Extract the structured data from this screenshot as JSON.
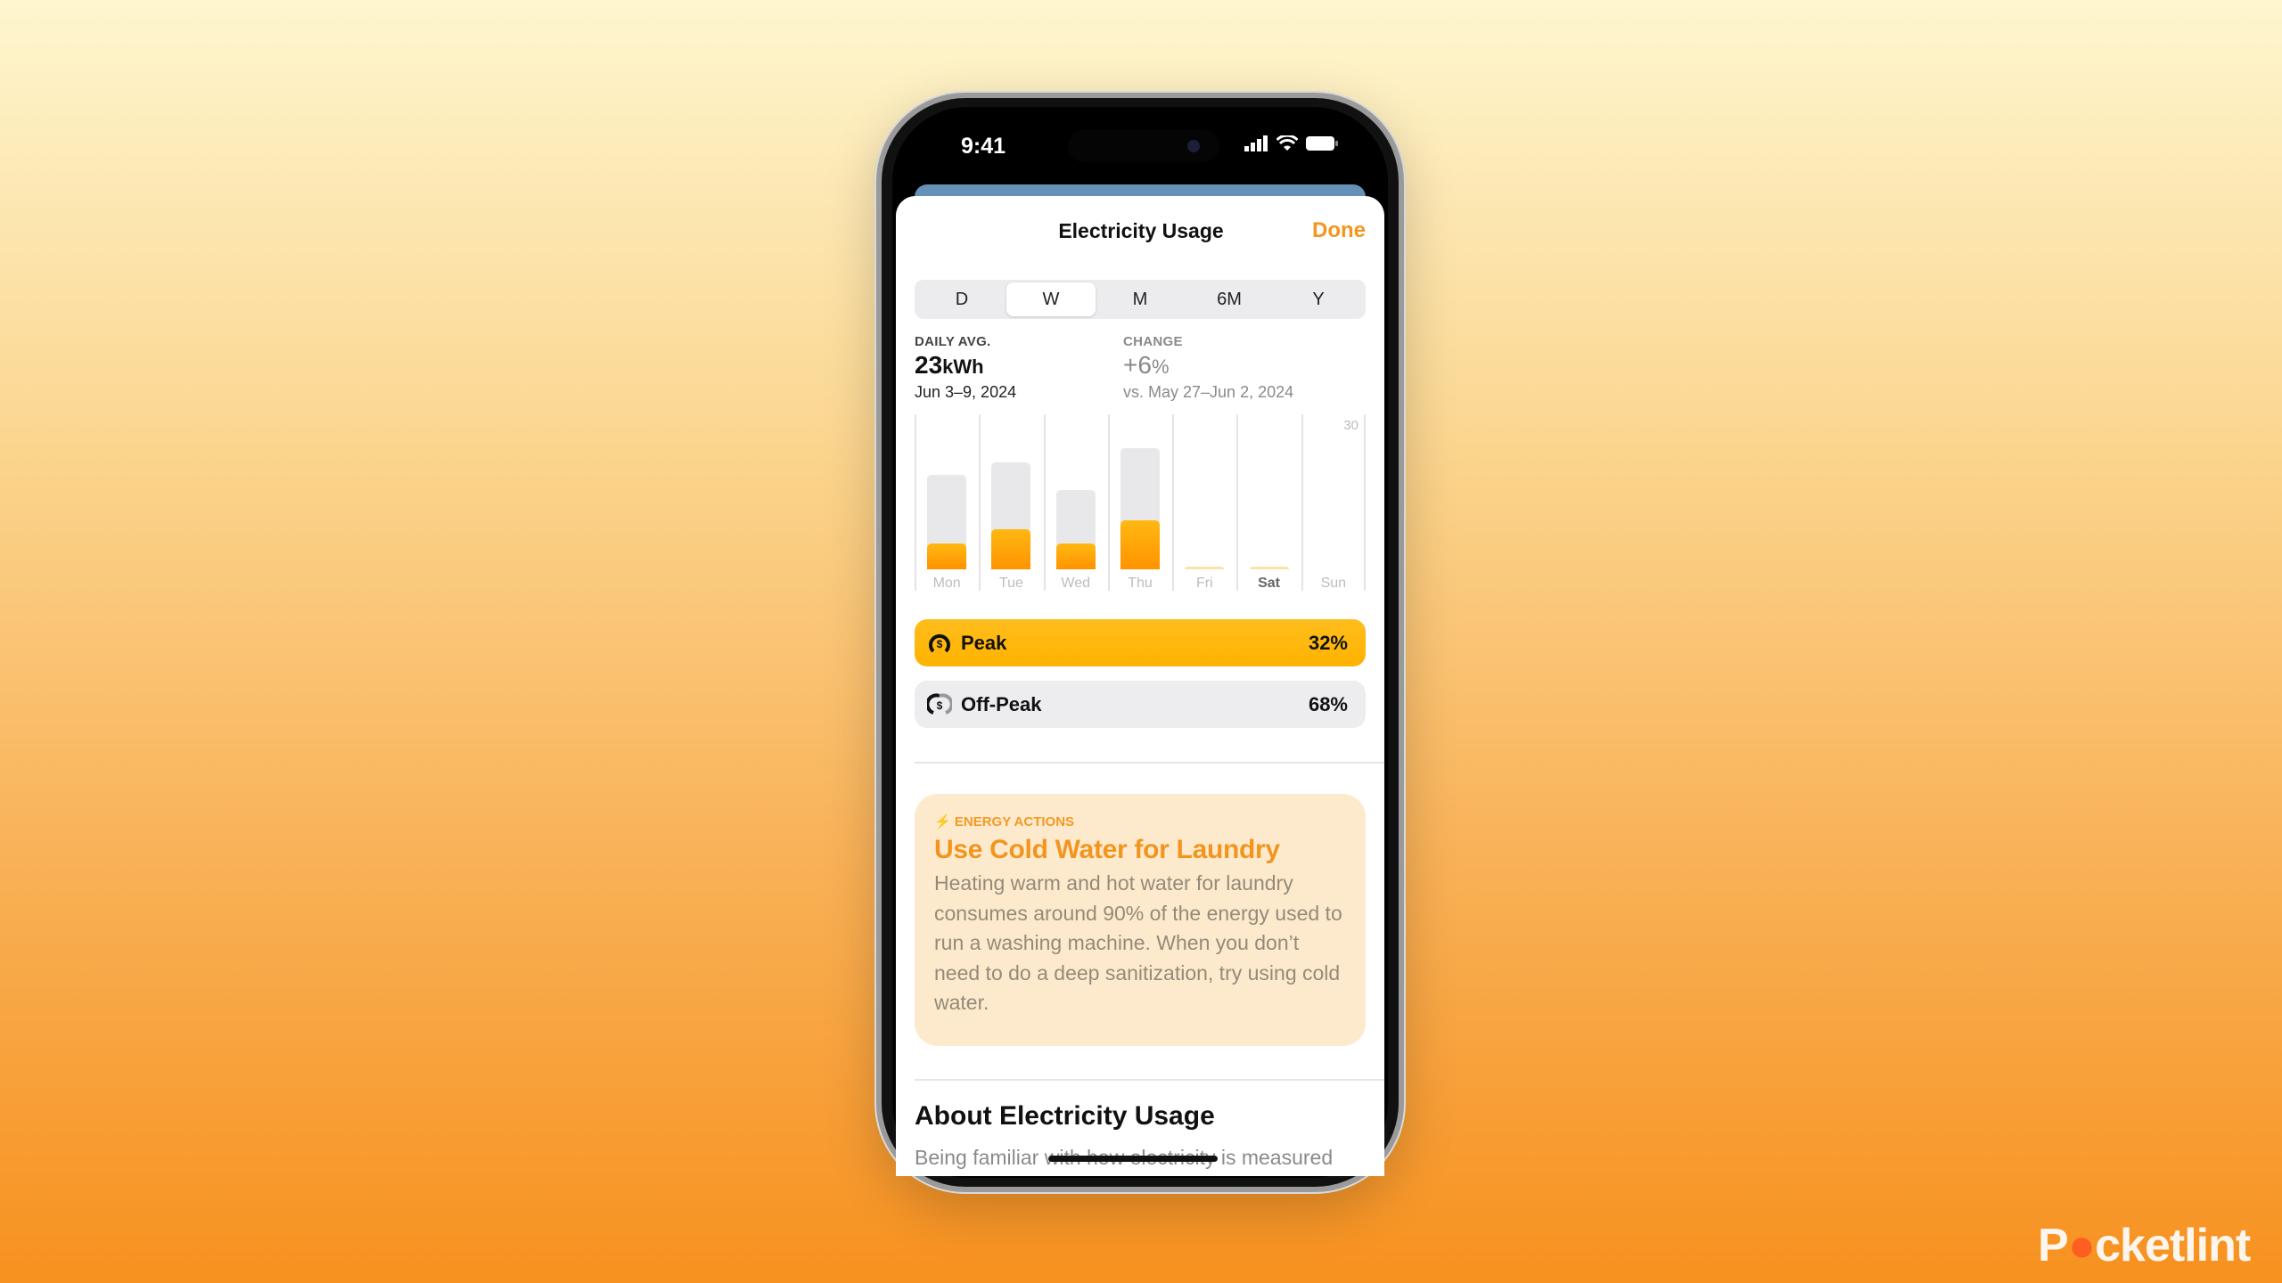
{
  "status_bar": {
    "time": "9:41",
    "icons": [
      "cellular-signal-icon",
      "wifi-icon",
      "battery-icon"
    ]
  },
  "header": {
    "title": "Electricity Usage",
    "done_label": "Done"
  },
  "segments": [
    {
      "label": "D",
      "selected": false
    },
    {
      "label": "W",
      "selected": true
    },
    {
      "label": "M",
      "selected": false
    },
    {
      "label": "6M",
      "selected": false
    },
    {
      "label": "Y",
      "selected": false
    }
  ],
  "summary": {
    "daily_avg_label": "DAILY AVG.",
    "daily_avg_value": "23",
    "daily_avg_unit": "kWh",
    "date_range": "Jun 3–9, 2024",
    "change_label": "CHANGE",
    "change_value": "+6",
    "change_unit": "%",
    "compare_range": "vs. May 27–Jun 2, 2024"
  },
  "chart_data": {
    "type": "bar",
    "categories": [
      "Mon",
      "Tue",
      "Wed",
      "Thu",
      "Fri",
      "Sat",
      "Sun"
    ],
    "ylim": [
      0,
      30
    ],
    "ytick_labels": [
      "30"
    ],
    "series": [
      {
        "values": [
          18.2,
          20.7,
          15.3,
          23.4,
          0,
          0,
          null
        ]
      },
      {
        "name": "Peak",
        "values": [
          5.0,
          7.7,
          5.0,
          9.4,
          0,
          0,
          null
        ]
      }
    ],
    "highlighted_category": "Sat",
    "colors": {
      "total": "#e8e8ea",
      "peak": "#ff9f0a"
    }
  },
  "breakdown": [
    {
      "label": "Peak",
      "value": "32%",
      "icon": "peak-dollar-gauge-icon",
      "color": "#ffb80f"
    },
    {
      "label": "Off-Peak",
      "value": "68%",
      "icon": "offpeak-dollar-gauge-icon",
      "color": "#ededef"
    }
  ],
  "energy_card": {
    "tag": "ENERGY ACTIONS",
    "icon": "bolt-icon",
    "title": "Use Cold Water for Laundry",
    "body": "Heating warm and hot water for laundry consumes around 90% of the energy used to run a washing machine. When you don’t need to do a deep sanitization, try using cold water."
  },
  "about": {
    "heading": "About Electricity Usage",
    "body": "Being familiar with how electricity is measured"
  },
  "watermark": "Pocketlint",
  "accent": "#f4951e"
}
